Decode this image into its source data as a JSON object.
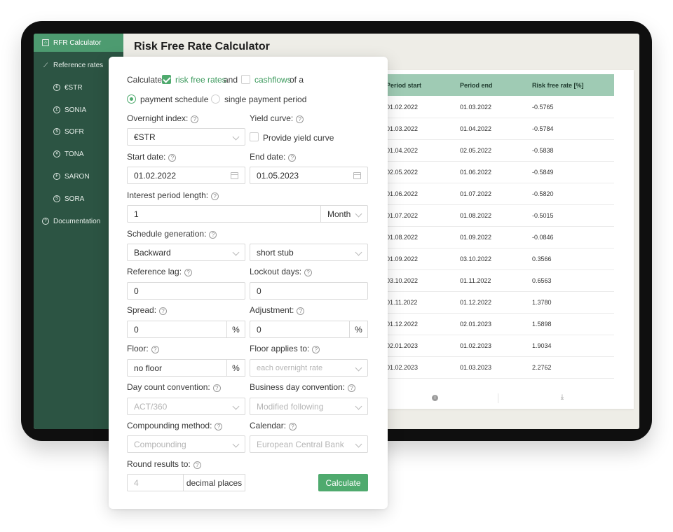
{
  "app": {
    "title": "Risk Free Rate Calculator"
  },
  "sidebar": {
    "items": [
      {
        "label": "RFR Calculator",
        "icon": "bank-icon",
        "active": true
      },
      {
        "label": "Reference rates",
        "icon": "chart-line-icon"
      },
      {
        "label": "€STR",
        "icon": "euro-coin-icon"
      },
      {
        "label": "SONIA",
        "icon": "pound-coin-icon"
      },
      {
        "label": "SOFR",
        "icon": "dollar-coin-icon"
      },
      {
        "label": "TONA",
        "icon": "yen-coin-icon"
      },
      {
        "label": "SARON",
        "icon": "franc-coin-icon"
      },
      {
        "label": "SORA",
        "icon": "sgd-coin-icon"
      },
      {
        "label": "Documentation",
        "icon": "help-circle-icon"
      }
    ]
  },
  "table": {
    "headers": [
      "Period start",
      "Period end",
      "Risk free rate [%]"
    ],
    "rows": [
      [
        "01.02.2022",
        "01.03.2022",
        "-0.5765"
      ],
      [
        "01.03.2022",
        "01.04.2022",
        "-0.5784"
      ],
      [
        "01.04.2022",
        "02.05.2022",
        "-0.5838"
      ],
      [
        "02.05.2022",
        "01.06.2022",
        "-0.5849"
      ],
      [
        "01.06.2022",
        "01.07.2022",
        "-0.5820"
      ],
      [
        "01.07.2022",
        "01.08.2022",
        "-0.5015"
      ],
      [
        "01.08.2022",
        "01.09.2022",
        "-0.0846"
      ],
      [
        "01.09.2022",
        "03.10.2022",
        "0.3566"
      ],
      [
        "03.10.2022",
        "01.11.2022",
        "0.6563"
      ],
      [
        "01.11.2022",
        "01.12.2022",
        "1.3780"
      ],
      [
        "01.12.2022",
        "02.01.2023",
        "1.5898"
      ],
      [
        "02.01.2023",
        "01.02.2023",
        "1.9034"
      ],
      [
        "01.02.2023",
        "01.03.2023",
        "2.2762"
      ]
    ]
  },
  "form": {
    "calc_prefix": "Calculate",
    "risk_free_rates_label": "risk free rates",
    "and_label": "and",
    "cashflows_label": "cashflows",
    "of_a_label": "of a",
    "radio_payment_schedule": "payment schedule",
    "radio_single_payment": "single payment period",
    "overnight_index_label": "Overnight index:",
    "overnight_index_value": "€STR",
    "yield_curve_label": "Yield curve:",
    "provide_yield_curve_label": "Provide yield curve",
    "start_date_label": "Start date:",
    "start_date_value": "01.02.2022",
    "end_date_label": "End date:",
    "end_date_value": "01.05.2023",
    "interest_period_label": "Interest period length:",
    "interest_period_value": "1",
    "interest_period_unit": "Month",
    "schedule_generation_label": "Schedule generation:",
    "schedule_direction_value": "Backward",
    "stub_value": "short stub",
    "reference_lag_label": "Reference lag:",
    "reference_lag_value": "0",
    "lockout_days_label": "Lockout days:",
    "lockout_days_value": "0",
    "spread_label": "Spread:",
    "spread_value": "0",
    "adjustment_label": "Adjustment:",
    "adjustment_value": "0",
    "percent": "%",
    "floor_label": "Floor:",
    "floor_value": "no floor",
    "floor_applies_label": "Floor applies to:",
    "floor_applies_value": "each overnight rate",
    "day_count_label": "Day count convention:",
    "day_count_value": "ACT/360",
    "business_day_label": "Business day convention:",
    "business_day_value": "Modified following",
    "compounding_label": "Compounding method:",
    "compounding_value": "Compounding",
    "calendar_label": "Calendar:",
    "calendar_value": "European Central Bank",
    "round_label": "Round results to:",
    "round_placeholder": "4",
    "decimal_places": "decimal places",
    "calculate_button": "Calculate"
  }
}
